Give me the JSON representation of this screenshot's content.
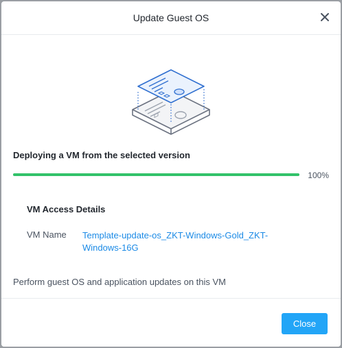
{
  "dialog": {
    "title": "Update Guest OS",
    "close_icon": "close-icon"
  },
  "deploy": {
    "status_text": "Deploying a VM from the selected version",
    "progress_percent": 100,
    "progress_label": "100%"
  },
  "access": {
    "title": "VM Access Details",
    "vm_name_label": "VM Name",
    "vm_name_value": "Template-update-os_ZKT-Windows-Gold_ZKT-Windows-16G"
  },
  "footer_note": "Perform guest OS and application updates on this VM",
  "buttons": {
    "close_label": "Close"
  },
  "colors": {
    "accent": "#22a5f7",
    "progress": "#32c26a",
    "link": "#1b8ae6"
  }
}
